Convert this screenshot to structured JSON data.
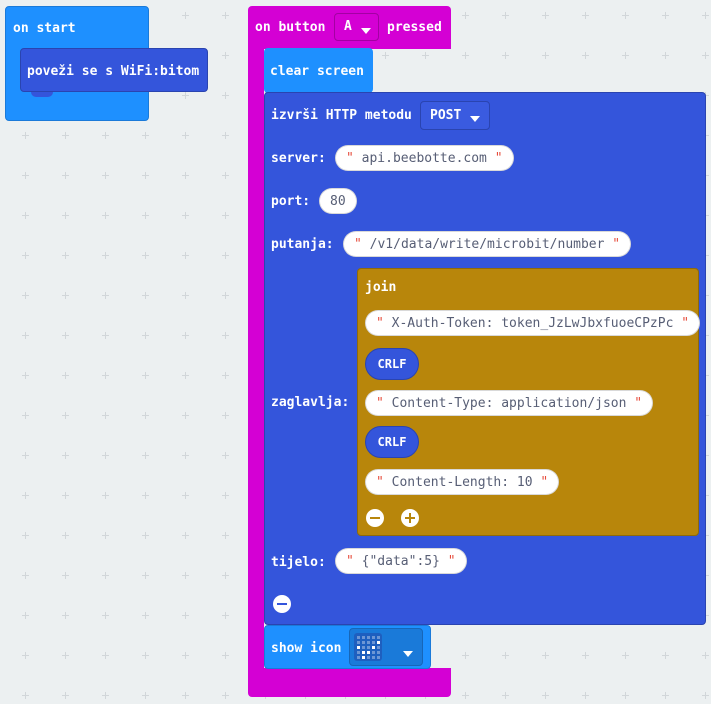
{
  "on_start": {
    "label": "on start",
    "child_label": "poveži se s WiFi:bitom"
  },
  "on_button": {
    "label_prefix": "on button",
    "button_value": "A",
    "label_suffix": "pressed"
  },
  "clear_screen": {
    "label": "clear screen"
  },
  "http": {
    "label": "izvrši HTTP metodu",
    "method": "POST",
    "server_label": "server:",
    "server_value": "api.beebotte.com",
    "port_label": "port:",
    "port_value": "80",
    "path_label": "putanja:",
    "path_value": "/v1/data/write/microbit/number",
    "headers_label": "zaglavlja:",
    "body_label": "tijelo:",
    "body_value": "{\"data\":5}"
  },
  "join": {
    "label": "join",
    "item1": "X-Auth-Token: token_JzLwJbxfuoeCPzPc",
    "crlf1": "CRLF",
    "item2": "Content-Type: application/json",
    "crlf2": "CRLF",
    "item3": "Content-Length: 10"
  },
  "show_icon": {
    "label": "show icon"
  },
  "colors": {
    "workspace": "#ecf0f1",
    "basic_blue": "#1e90ff",
    "custom_blue": "#3455db",
    "input_magenta": "#d400d4",
    "text_gold": "#b8860b"
  }
}
